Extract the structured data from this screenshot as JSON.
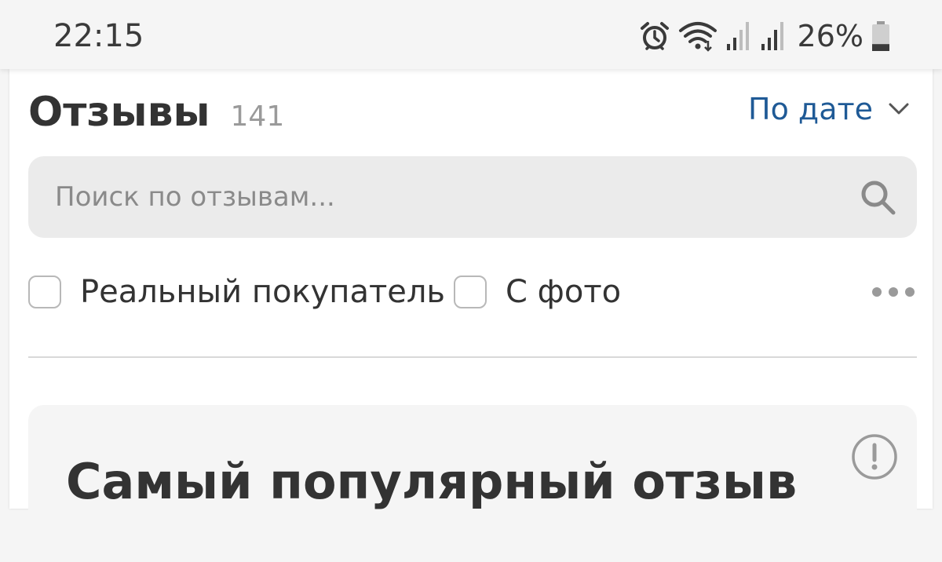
{
  "status_bar": {
    "time": "22:15",
    "battery_percent": "26%",
    "battery_level": 0.26,
    "icons": [
      "alarm-icon",
      "wifi-icon",
      "signal-icon",
      "signal-icon",
      "battery-icon"
    ]
  },
  "reviews": {
    "title": "Отзывы",
    "count": "141",
    "sort_label": "По дате",
    "search_placeholder": "Поиск по отзывам...",
    "filters": [
      {
        "label": "Реальный покупатель",
        "checked": false
      },
      {
        "label": "С фото",
        "checked": false
      }
    ]
  },
  "popular_review": {
    "title": "Самый популярный отзыв"
  },
  "colors": {
    "accent": "#1f5a96",
    "text_primary": "#333333",
    "text_muted": "#9a9a9a",
    "search_bg": "#ebebeb",
    "page_bg": "#f5f5f5"
  }
}
